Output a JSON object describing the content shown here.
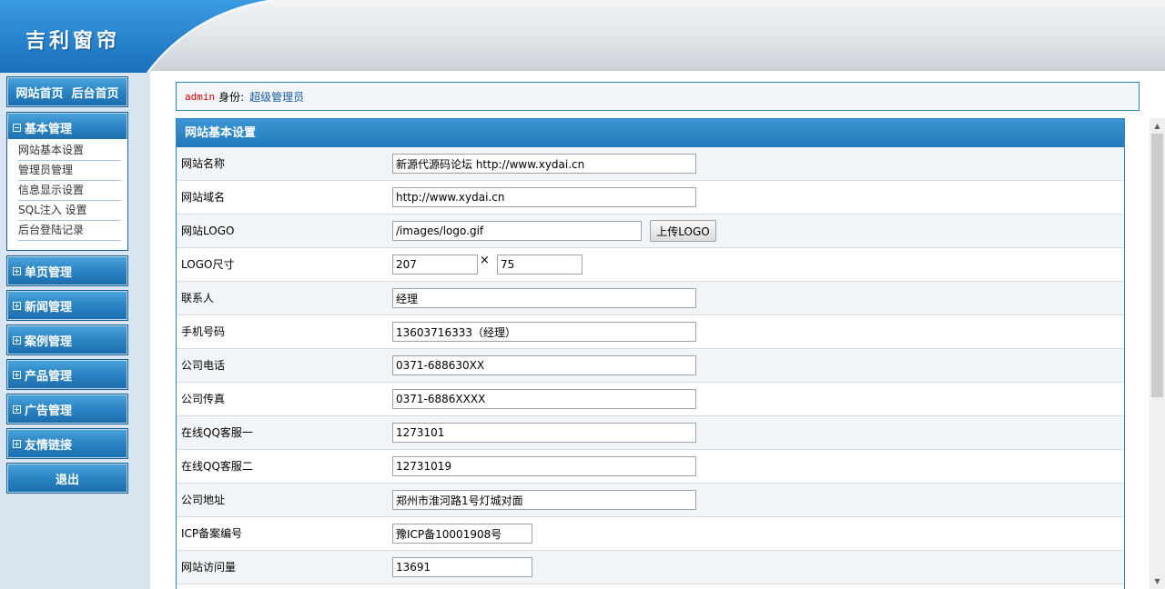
{
  "header": {
    "logo": "吉利窗帘"
  },
  "sidebar": {
    "top_nav": "网站首页  后台首页",
    "groups": [
      {
        "label": "基本管理",
        "expanded": true
      },
      {
        "label": "单页管理",
        "expanded": false
      },
      {
        "label": "新闻管理",
        "expanded": false
      },
      {
        "label": "案例管理",
        "expanded": false
      },
      {
        "label": "产品管理",
        "expanded": false
      },
      {
        "label": "广告管理",
        "expanded": false
      },
      {
        "label": "友情链接",
        "expanded": false
      }
    ],
    "sub_items": [
      "网站基本设置",
      "管理员管理",
      "信息显示设置",
      "SQL注入 设置",
      "后台登陆记录"
    ],
    "logout": "退出"
  },
  "userbar": {
    "user": "admin",
    "role_label": "身份:",
    "role": "超级管理员"
  },
  "panel": {
    "title": "网站基本设置",
    "fields": [
      {
        "label": "网站名称",
        "value": "新源代源码论坛 http://www.xydai.cn"
      },
      {
        "label": "网站域名",
        "value": "http://www.xydai.cn"
      },
      {
        "label": "网站LOGO",
        "value": "/images/logo.gif",
        "button": "上传LOGO"
      },
      {
        "label": "LOGO尺寸",
        "width": "207",
        "times": "×",
        "height": "75"
      },
      {
        "label": "联系人",
        "value": "经理"
      },
      {
        "label": "手机号码",
        "value": "13603716333（经理）"
      },
      {
        "label": "公司电话",
        "value": "0371-688630XX"
      },
      {
        "label": "公司传真",
        "value": "0371-6886XXXX"
      },
      {
        "label": "在线QQ客服一",
        "value": "1273101"
      },
      {
        "label": "在线QQ客服二",
        "value": "12731019"
      },
      {
        "label": "公司地址",
        "value": "郑州市淮河路1号灯城对面"
      },
      {
        "label": "ICP备案编号",
        "value": "豫ICP备10001908号"
      },
      {
        "label": "网站访问量",
        "value": "13691"
      }
    ]
  },
  "colors": {
    "accent": "#2b86c5",
    "sidebar_bg": "#d9e6f2",
    "admin": "#dd0000"
  },
  "icons": {
    "expand": "plus-box-icon",
    "collapse": "minus-box-icon"
  }
}
